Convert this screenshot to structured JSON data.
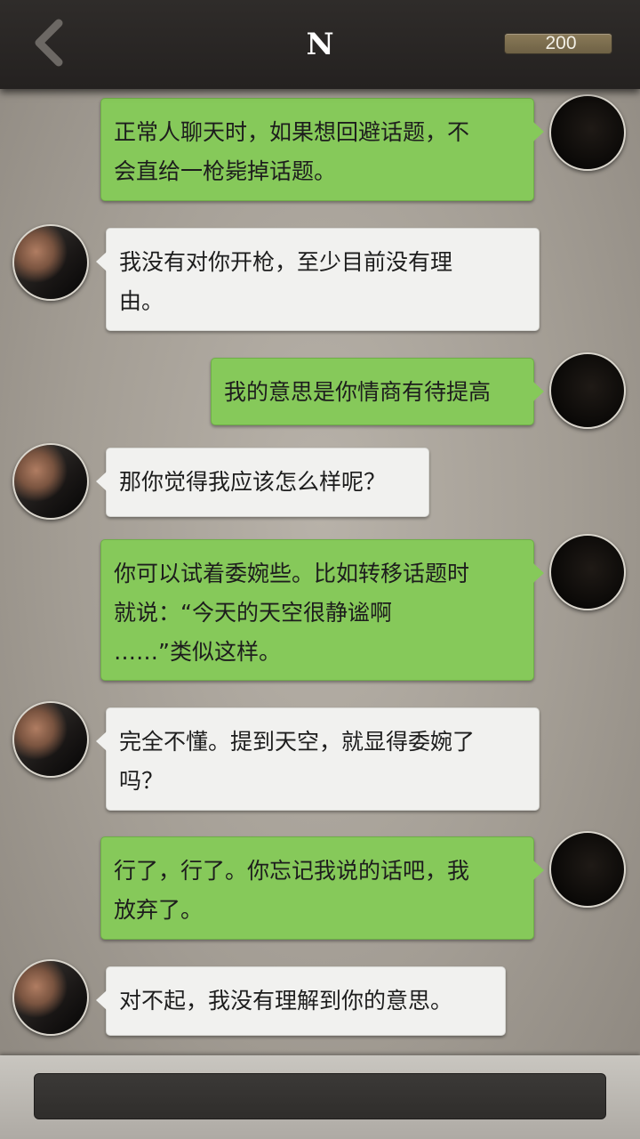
{
  "header": {
    "title": "N",
    "coins": "200",
    "back_icon": "chevron-left-icon"
  },
  "messages": [
    {
      "sender": "me",
      "text": "正常人聊天时，如果想回避话题，不\n会直给一枪毙掉话题。"
    },
    {
      "sender": "other",
      "text": "我没有对你开枪，至少目前没有理\n由。"
    },
    {
      "sender": "me",
      "text": "我的意思是你情商有待提高"
    },
    {
      "sender": "other",
      "text": "那你觉得我应该怎么样呢？"
    },
    {
      "sender": "me",
      "text": "你可以试着委婉些。比如转移话题时\n就说：“今天的天空很静谧啊\n……”类似这样。"
    },
    {
      "sender": "other",
      "text": "完全不懂。提到天空，就显得委婉了\n吗？"
    },
    {
      "sender": "me",
      "text": "行了，行了。你忘记我说的话吧，我\n放弃了。"
    },
    {
      "sender": "other",
      "text": "对不起，我没有理解到你的意思。"
    }
  ],
  "input": {
    "placeholder": "",
    "value": ""
  },
  "colors": {
    "me_bubble": "#86c95a",
    "other_bubble": "#f1f1ef",
    "header_bg": "#2a2725"
  }
}
